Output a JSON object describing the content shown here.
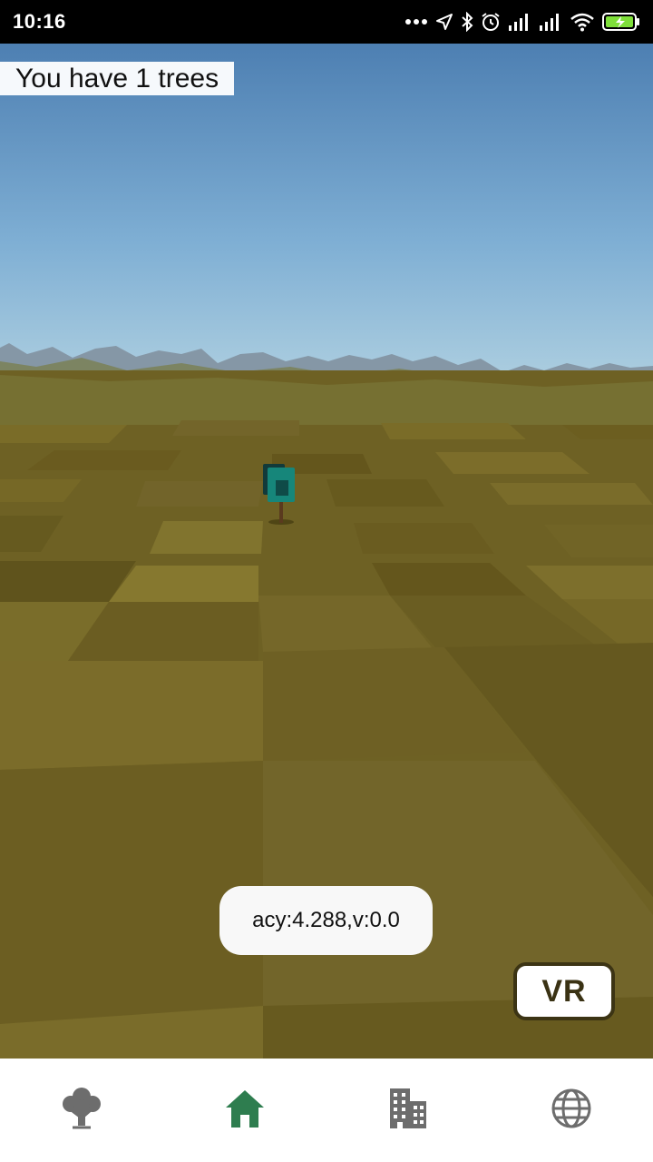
{
  "status_bar": {
    "time": "10:16",
    "icons": [
      "more-dots-icon",
      "location-arrow-icon",
      "bluetooth-icon",
      "alarm-icon",
      "signal-icon",
      "signal-icon",
      "wifi-icon",
      "battery-charging-icon"
    ]
  },
  "hud": {
    "tree_count_text": "You have 1 trees"
  },
  "toast": {
    "text": "acy:4.288,v:0.0"
  },
  "vr_button": {
    "label": "VR"
  },
  "bottom_nav": {
    "items": [
      {
        "icon": "tree-icon",
        "active": false
      },
      {
        "icon": "home-icon",
        "active": true
      },
      {
        "icon": "buildings-icon",
        "active": false
      },
      {
        "icon": "globe-icon",
        "active": false
      }
    ]
  },
  "colors": {
    "sky_top": "#4a7fb4",
    "sky_horizon": "#a9cde0",
    "ground": "#6e6022",
    "nav_active": "#2e7d4f",
    "nav_inactive": "#6d6d6d"
  }
}
